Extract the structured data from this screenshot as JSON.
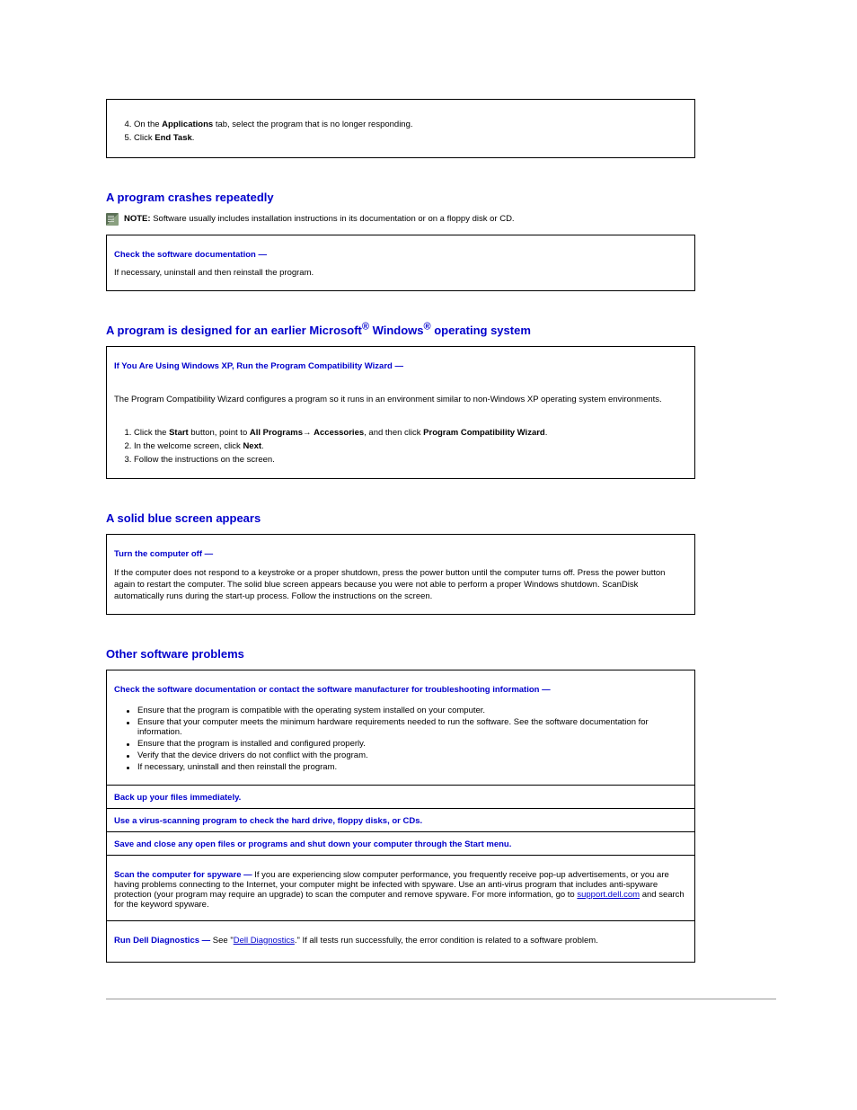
{
  "box1": {
    "lines": [
      "On the Applications tab, select the program that is no longer responding.",
      "Click End Task."
    ],
    "start_index": 4
  },
  "sec1": {
    "heading": "A program crashes repeatedly",
    "note_label": "NOTE:",
    "note_text": "Software usually includes installation instructions in its documentation or on a floppy disk or CD.",
    "lead": "Check the software documentation —",
    "text": "If necessary, uninstall and then reinstall the program."
  },
  "sec2": {
    "heading_pre": "A program is designed for an earlier Microsoft",
    "heading_mid": " Windows",
    "heading_post": " operating system",
    "lead": "If You Are Using Windows XP, Run the Program Compatibility Wizard —",
    "para": "The Program Compatibility Wizard configures a program so it runs in an environment similar to non-Windows XP operating system environments.",
    "step1_a": "Click the ",
    "step1_b": "Start",
    "step1_c": " button, point to ",
    "step1_d": "All Programs",
    "step1_e": "Accessories",
    "step1_f": ", and then click ",
    "step1_g": "Program Compatibility Wizard",
    "step1_h": ".",
    "arrow": "→",
    "step2_a": "In the welcome screen, click ",
    "step2_b": "Next",
    "step2_c": ".",
    "step3": "Follow the instructions on the screen."
  },
  "sec3": {
    "heading": "A solid blue screen appears",
    "lead": "Turn the computer off —",
    "text": "If the computer does not respond to a keystroke or a proper shutdown, press the power button until the computer turns off. Press the power button again to restart the computer. The solid blue screen appears because you were not able to perform a proper Windows shutdown. ScanDisk automatically runs during the start-up process. Follow the instructions on the screen."
  },
  "sec4": {
    "heading": "Other software problems",
    "row1_lead": "Check the software documentation or contact the software manufacturer for troubleshooting information —",
    "row1_bullets": [
      "Ensure that the program is compatible with the operating system installed on your computer.",
      "Ensure that your computer meets the minimum hardware requirements needed to run the software. See the software documentation for information.",
      "Ensure that the program is installed and configured properly.",
      "Verify that the device drivers do not conflict with the program.",
      "If necessary, uninstall and then reinstall the program."
    ],
    "row2": "Back up your files immediately.",
    "row3": "Use a virus-scanning program to check the hard drive, floppy disks, or CDs.",
    "row4_lead": "Save and close any open files or programs and shut down your computer through the ",
    "row4_b": "Start",
    "row4_c": " menu.",
    "row5_lead": "Scan the computer for spyware —",
    "row5_text": "If you are experiencing slow computer performance, you frequently receive pop-up advertisements, or you are having problems connecting to the Internet, your computer might be infected with spyware. Use an anti-virus program that includes anti-spyware protection (your program may require an upgrade) to scan the computer and remove spyware. For more information, go to ",
    "row5_link": "support.dell.com",
    "row5_tail": " and search for the keyword spyware.",
    "row6_lead": "Run Dell Diagnostics —",
    "row6_a": "See \"",
    "row6_link": "Dell Diagnostics",
    "row6_b": ".\" If all tests run successfully, the error condition is related to a software problem."
  }
}
